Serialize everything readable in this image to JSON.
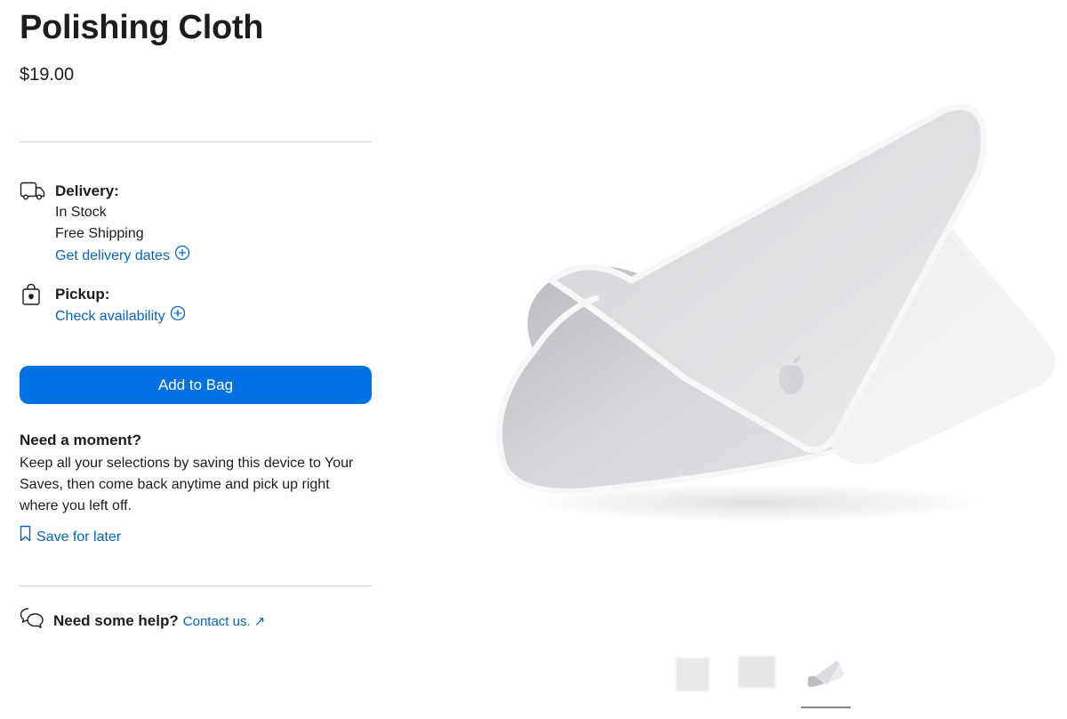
{
  "product": {
    "title": "Polishing Cloth",
    "price": "$19.00"
  },
  "delivery": {
    "icon": "truck-icon",
    "title": "Delivery:",
    "stock": "In Stock",
    "shipping": "Free Shipping",
    "link": "Get delivery dates"
  },
  "pickup": {
    "icon": "shopping-bag-icon",
    "title": "Pickup:",
    "link": "Check availability"
  },
  "actions": {
    "add_to_bag": "Add to Bag"
  },
  "saves": {
    "title": "Need a moment?",
    "text": "Keep all your selections by saving this device to Your Saves, then come back anytime and pick up right where you left off.",
    "link": "Save for later",
    "icon": "bookmark-icon"
  },
  "help": {
    "icon": "chat-bubbles-icon",
    "title": "Need some help?",
    "link": "Contact us. ↗"
  },
  "gallery": {
    "selected_index": 2,
    "thumbnails": [
      "cloth-flat",
      "cloth-square",
      "cloth-folded"
    ]
  },
  "colors": {
    "accent": "#0071e3",
    "link": "#0066cc",
    "text": "#1d1d1f",
    "divider": "#d2d2d7"
  }
}
